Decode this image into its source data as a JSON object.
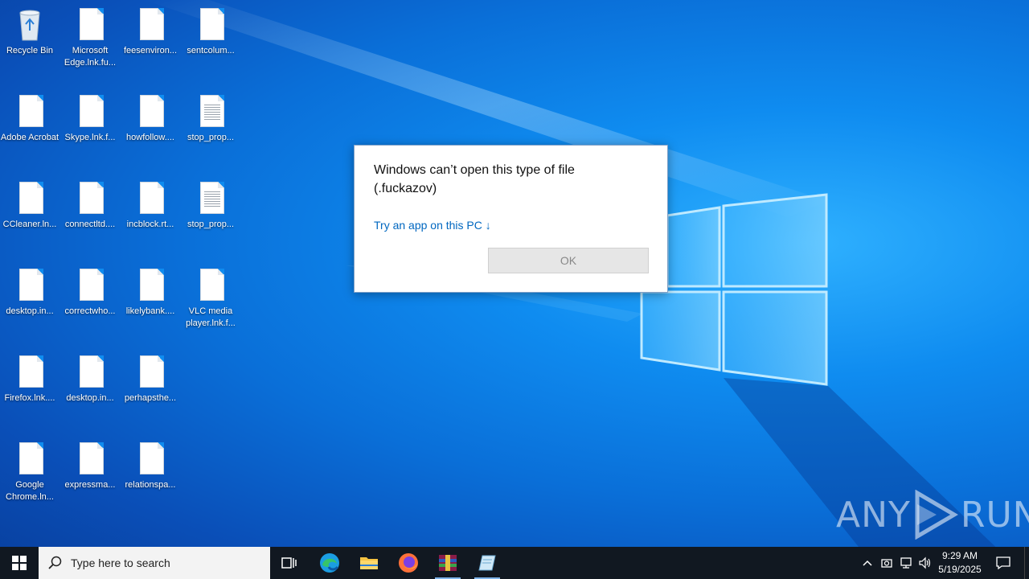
{
  "desktop": {
    "icons": [
      {
        "label": "Recycle Bin",
        "type": "recycle"
      },
      {
        "label": "Microsoft Edge.lnk.fu...",
        "type": "file"
      },
      {
        "label": "feesenviron...",
        "type": "file"
      },
      {
        "label": "sentcolum...",
        "type": "file"
      },
      {
        "label": "Adobe Acrobat",
        "type": "file"
      },
      {
        "label": "Skype.lnk.f...",
        "type": "file"
      },
      {
        "label": "howfollow....",
        "type": "file"
      },
      {
        "label": "stop_prop...",
        "type": "text"
      },
      {
        "label": "CCleaner.ln...",
        "type": "file"
      },
      {
        "label": "connectltd....",
        "type": "file"
      },
      {
        "label": "incblock.rt...",
        "type": "file"
      },
      {
        "label": "stop_prop...",
        "type": "text"
      },
      {
        "label": "desktop.in...",
        "type": "file"
      },
      {
        "label": "correctwho...",
        "type": "file"
      },
      {
        "label": "likelybank....",
        "type": "file"
      },
      {
        "label": "VLC media player.lnk.f...",
        "type": "file"
      },
      {
        "label": "Firefox.lnk....",
        "type": "file"
      },
      {
        "label": "desktop.in...",
        "type": "file"
      },
      {
        "label": "perhapsthe...",
        "type": "file"
      },
      {
        "label": "Google Chrome.ln...",
        "type": "file"
      },
      {
        "label": "expressma...",
        "type": "file"
      },
      {
        "label": "relationspa...",
        "type": "file"
      }
    ]
  },
  "dialog": {
    "title": "Windows can’t open this type of file (.fuckazov)",
    "link": "Try an app on this PC ↓",
    "ok": "OK"
  },
  "watermark": {
    "text_left": "ANY",
    "text_right": "RUN"
  },
  "taskbar": {
    "search_placeholder": "Type here to search",
    "clock_time": "9:29 AM",
    "clock_date": "5/19/2025",
    "apps": [
      "task-view",
      "edge",
      "file-explorer",
      "firefox",
      "winrar",
      "notepad-app"
    ]
  }
}
